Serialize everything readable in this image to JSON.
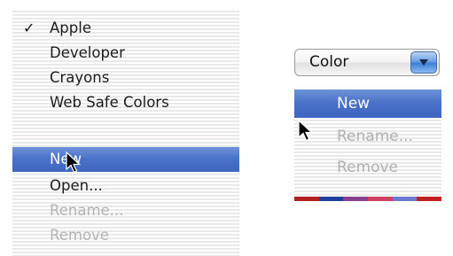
{
  "left_menu": {
    "items": [
      {
        "label": "Apple",
        "checked": true,
        "check_glyph": "✓"
      },
      {
        "label": "Developer"
      },
      {
        "label": "Crayons"
      },
      {
        "label": "Web Safe Colors"
      }
    ],
    "actions": [
      {
        "label": "New",
        "state": "highlighted"
      },
      {
        "label": "Open...",
        "state": "enabled"
      },
      {
        "label": "Rename...",
        "state": "disabled"
      },
      {
        "label": "Remove",
        "state": "disabled"
      }
    ]
  },
  "right_popup": {
    "selected_value": "Color",
    "icon": "chevron-down-icon",
    "menu": [
      {
        "label": "New",
        "state": "highlighted"
      },
      {
        "label": "Rename...",
        "state": "disabled"
      },
      {
        "label": "Remove",
        "state": "disabled"
      }
    ],
    "swatch_colors": [
      "#b02020",
      "#2040a0",
      "#8a4090",
      "#d04060",
      "#6a7ad0",
      "#c02020"
    ]
  },
  "colors": {
    "highlight": "#4a72c8",
    "disabled_text": "#b4b4b4",
    "text": "#1c1c1c"
  }
}
